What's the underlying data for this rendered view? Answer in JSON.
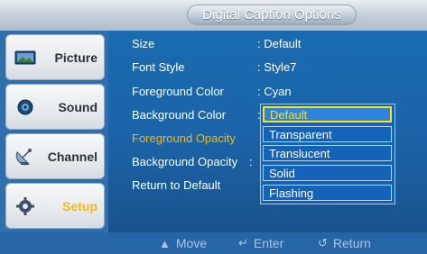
{
  "window": {
    "title": "Digital Caption Options"
  },
  "sidebar": {
    "items": [
      {
        "label": "Picture",
        "icon": "picture-icon"
      },
      {
        "label": "Sound",
        "icon": "sound-icon"
      },
      {
        "label": "Channel",
        "icon": "channel-icon"
      },
      {
        "label": "Setup",
        "icon": "setup-gear-icon"
      }
    ],
    "active": "Setup"
  },
  "settings": [
    {
      "label": "Size",
      "value": ": Default"
    },
    {
      "label": "Font Style",
      "value": ": Style7"
    },
    {
      "label": "Foreground Color",
      "value": ": Cyan"
    },
    {
      "label": "Background Color",
      "value": ":"
    },
    {
      "label": "Foreground Opacity",
      "value": ""
    },
    {
      "label": "Background Opacity",
      "value": ":"
    },
    {
      "label": "Return to Default",
      "value": ""
    }
  ],
  "dropdown": {
    "options": [
      "Default",
      "Transparent",
      "Translucent",
      "Solid",
      "Flashing"
    ],
    "selected": "Default"
  },
  "footer": {
    "move_label": "Move",
    "enter_label": "Enter",
    "return_label": "Return"
  },
  "colors": {
    "background": "#1b63a6",
    "highlight": "#f7b70e",
    "selected_border": "#ffe500"
  }
}
